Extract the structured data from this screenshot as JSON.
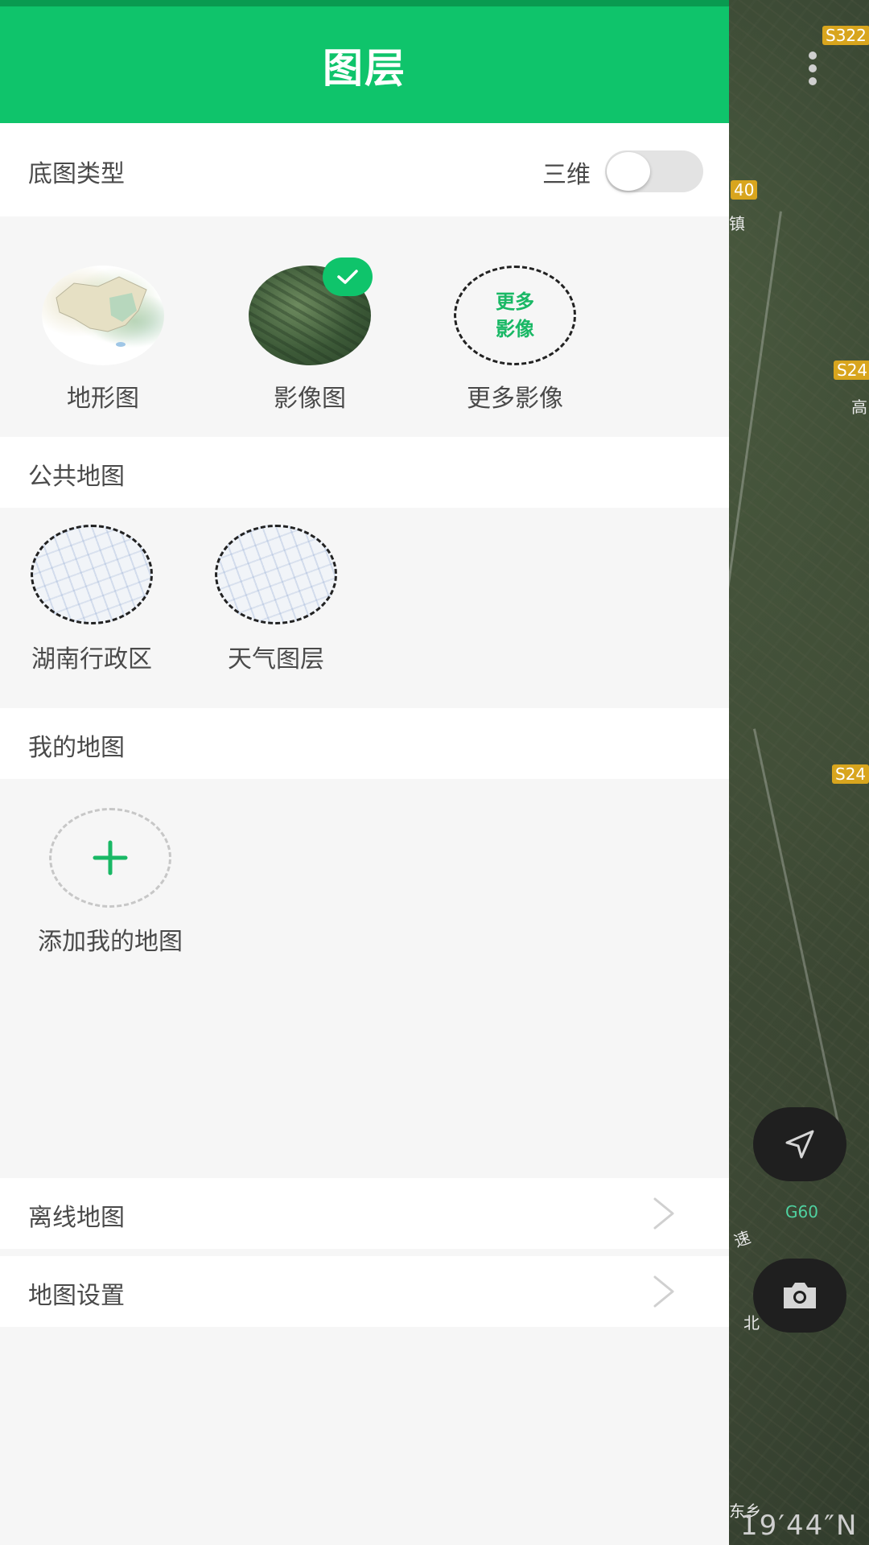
{
  "header": {
    "title": "图层"
  },
  "basemap": {
    "section_label": "底图类型",
    "toggle_label": "三维",
    "toggle_on": false,
    "tiles": [
      {
        "label": "地形图",
        "selected": false
      },
      {
        "label": "影像图",
        "selected": true
      },
      {
        "label": "更多影像",
        "thumb_line1": "更多",
        "thumb_line2": "影像",
        "selected": false
      }
    ]
  },
  "public_maps": {
    "section_label": "公共地图",
    "tiles": [
      {
        "label": "湖南行政区"
      },
      {
        "label": "天气图层"
      }
    ]
  },
  "my_maps": {
    "section_label": "我的地图",
    "add_label": "添加我的地图"
  },
  "nav": {
    "offline_maps": "离线地图",
    "map_settings": "地图设置"
  },
  "map": {
    "road_labels": [
      "S322",
      "40",
      "S24",
      "S24",
      "G60"
    ],
    "place_labels": [
      "镇",
      "高",
      "北",
      "速",
      "东乡"
    ],
    "coordinate_text": "19′44″N"
  },
  "colors": {
    "accent": "#0fc46b",
    "status_bar": "#099a50",
    "panel_bg": "#f6f6f6",
    "text": "#4a4a4a"
  }
}
